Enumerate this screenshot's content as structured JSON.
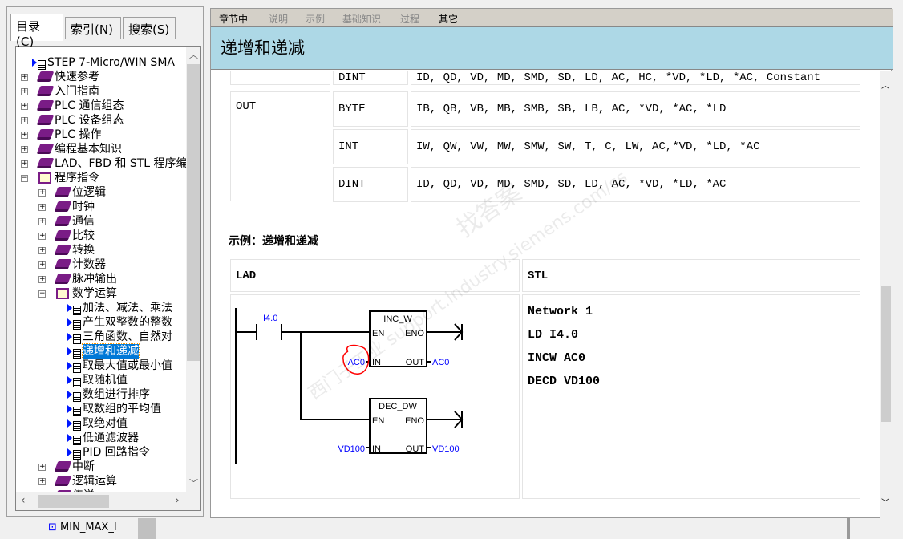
{
  "left_pane": {
    "tabs": [
      {
        "label": "目录(C)",
        "active": true
      },
      {
        "label": "索引(N)"
      },
      {
        "label": "搜索(S)"
      }
    ],
    "tree": [
      {
        "label": "STEP 7-Micro/WIN SMA",
        "level": 0,
        "type": "page"
      },
      {
        "label": "快速参考",
        "level": 0,
        "type": "book"
      },
      {
        "label": "入门指南",
        "level": 0,
        "type": "book"
      },
      {
        "label": "PLC 通信组态",
        "level": 0,
        "type": "book"
      },
      {
        "label": "PLC 设备组态",
        "level": 0,
        "type": "book"
      },
      {
        "label": "PLC 操作",
        "level": 0,
        "type": "book"
      },
      {
        "label": "编程基本知识",
        "level": 0,
        "type": "book"
      },
      {
        "label": "LAD、FBD 和 STL 程序编",
        "level": 0,
        "type": "book"
      },
      {
        "label": "程序指令",
        "level": 0,
        "type": "open"
      },
      {
        "label": "位逻辑",
        "level": 1,
        "type": "book"
      },
      {
        "label": "时钟",
        "level": 1,
        "type": "book"
      },
      {
        "label": "通信",
        "level": 1,
        "type": "book"
      },
      {
        "label": "比较",
        "level": 1,
        "type": "book"
      },
      {
        "label": "转换",
        "level": 1,
        "type": "book"
      },
      {
        "label": "计数器",
        "level": 1,
        "type": "book"
      },
      {
        "label": "脉冲输出",
        "level": 1,
        "type": "book"
      },
      {
        "label": "数学运算",
        "level": 1,
        "type": "open"
      },
      {
        "label": "加法、减法、乘法",
        "level": 2,
        "type": "page"
      },
      {
        "label": "产生双整数的整数",
        "level": 2,
        "type": "page"
      },
      {
        "label": "三角函数、自然对",
        "level": 2,
        "type": "page"
      },
      {
        "label": "递增和递减",
        "level": 2,
        "type": "page",
        "selected": true
      },
      {
        "label": "取最大值或最小值",
        "level": 2,
        "type": "page"
      },
      {
        "label": "取随机值",
        "level": 2,
        "type": "page"
      },
      {
        "label": "数组进行排序",
        "level": 2,
        "type": "page"
      },
      {
        "label": "取数组的平均值",
        "level": 2,
        "type": "page"
      },
      {
        "label": "取绝对值",
        "level": 2,
        "type": "page"
      },
      {
        "label": "低通滤波器",
        "level": 2,
        "type": "page"
      },
      {
        "label": "PID 回路指令",
        "level": 2,
        "type": "page"
      },
      {
        "label": "中断",
        "level": 1,
        "type": "book"
      },
      {
        "label": "逻辑运算",
        "level": 1,
        "type": "book"
      },
      {
        "label": "传送",
        "level": 1,
        "type": "book"
      }
    ],
    "below_item": "MIN_MAX_I"
  },
  "nav": {
    "items": [
      {
        "label": "章节中",
        "active": true
      },
      {
        "label": "说明"
      },
      {
        "label": "示例"
      },
      {
        "label": "基础知识"
      },
      {
        "label": "过程"
      },
      {
        "label": "其它",
        "active": true
      }
    ]
  },
  "title": "递增和递减",
  "operand_table": {
    "partial_row": {
      "type": "DINT",
      "operands": "ID, QD, VD, MD, SMD, SD, LD, AC, HC, *VD, *LD, *AC, Constant"
    },
    "param": "OUT",
    "rows": [
      {
        "type": "BYTE",
        "operands": "IB, QB, VB, MB, SMB, SB, LB, AC, *VD, *AC, *LD"
      },
      {
        "type": "INT",
        "operands": "IW, QW, VW, MW, SMW, SW, T, C, LW, AC,*VD, *LD, *AC"
      },
      {
        "type": "DINT",
        "operands": "ID, QD, VD, MD, SMD, SD, LD, AC, *VD, *LD, *AC"
      }
    ]
  },
  "example": {
    "heading": "示例：递增和递减",
    "lad_header": "LAD",
    "stl_header": "STL",
    "lad": {
      "contact": "I4.0",
      "box1": {
        "name": "INC_W",
        "en": "EN",
        "eno": "ENO",
        "in": "IN",
        "out": "OUT",
        "in_val": "AC0",
        "out_val": "AC0"
      },
      "box2": {
        "name": "DEC_DW",
        "en": "EN",
        "eno": "ENO",
        "in": "IN",
        "out": "OUT",
        "in_val": "VD100",
        "out_val": "VD100"
      }
    },
    "stl": [
      "Network 1",
      "LD I4.0",
      "INCW AC0",
      "DECD VD100"
    ]
  },
  "watermark": {
    "line1": "西门子工业",
    "line2": "support.industry.siemens.com/cs",
    "line3": "找答案"
  },
  "colors": {
    "banner": "#add8e6",
    "nav": "#d4d0c8",
    "operand_blue": "#0000ff",
    "selection": "#0078d7",
    "annotation": "#ff0000"
  }
}
